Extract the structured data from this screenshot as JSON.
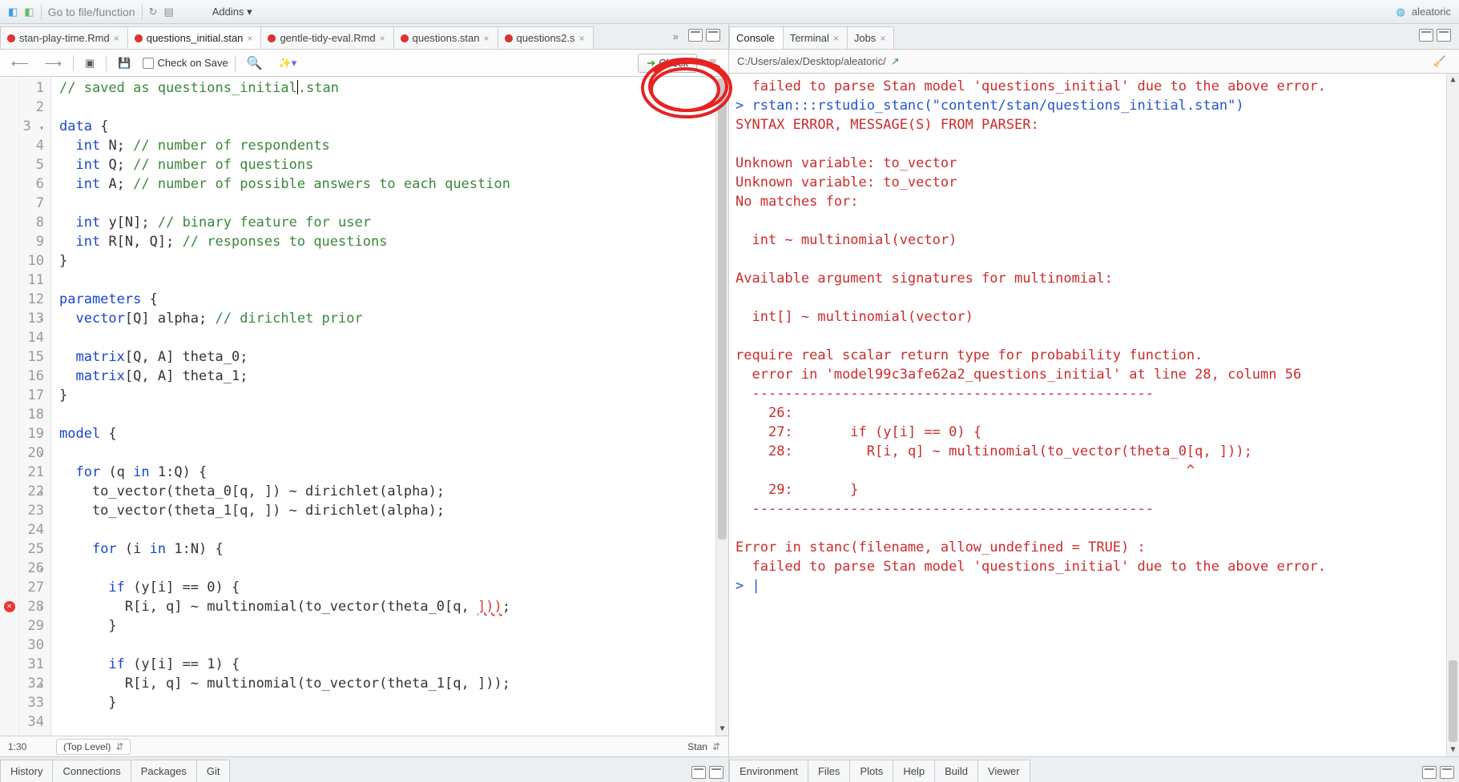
{
  "top": {
    "goto_placeholder": "Go to file/function",
    "addins_label": "Addins",
    "project_name": "aleatoric"
  },
  "editor": {
    "tabs": [
      {
        "label": "stan-play-time.Rmd",
        "active": false
      },
      {
        "label": "questions_initial.stan",
        "active": true
      },
      {
        "label": "gentle-tidy-eval.Rmd",
        "active": false
      },
      {
        "label": "questions.stan",
        "active": false
      },
      {
        "label": "questions2.s",
        "active": false
      }
    ],
    "toolbar": {
      "check_on_save": "Check on Save",
      "check_button": "Check"
    },
    "status": {
      "pos": "1:30",
      "scope": "(Top Level)",
      "lang": "Stan"
    },
    "lines": [
      {
        "n": 1,
        "fold": "",
        "html": "<span class='c-comment'>// saved as questions_initial<span class='cursor-bar'></span>.stan</span>"
      },
      {
        "n": 2,
        "fold": "",
        "html": ""
      },
      {
        "n": 3,
        "fold": "▾",
        "html": "<span class='c-key'>data</span> {"
      },
      {
        "n": 4,
        "fold": "",
        "html": "  <span class='c-type'>int</span> N; <span class='c-comment'>// number of respondents</span>"
      },
      {
        "n": 5,
        "fold": "",
        "html": "  <span class='c-type'>int</span> Q; <span class='c-comment'>// number of questions</span>"
      },
      {
        "n": 6,
        "fold": "",
        "html": "  <span class='c-type'>int</span> A; <span class='c-comment'>// number of possible answers to each question</span>"
      },
      {
        "n": 7,
        "fold": "",
        "html": ""
      },
      {
        "n": 8,
        "fold": "",
        "html": "  <span class='c-type'>int</span> y[N]; <span class='c-comment'>// binary feature for user</span>"
      },
      {
        "n": 9,
        "fold": "",
        "html": "  <span class='c-type'>int</span> R[N, Q]; <span class='c-comment'>// responses to questions</span>"
      },
      {
        "n": 10,
        "fold": "",
        "html": "}"
      },
      {
        "n": 11,
        "fold": "",
        "html": ""
      },
      {
        "n": 12,
        "fold": "▾",
        "html": "<span class='c-key'>parameters</span> {"
      },
      {
        "n": 13,
        "fold": "",
        "html": "  <span class='c-type'>vector</span>[Q] alpha; <span class='c-comment'>// dirichlet prior</span>"
      },
      {
        "n": 14,
        "fold": "",
        "html": ""
      },
      {
        "n": 15,
        "fold": "",
        "html": "  <span class='c-type'>matrix</span>[Q, A] theta_0;"
      },
      {
        "n": 16,
        "fold": "",
        "html": "  <span class='c-type'>matrix</span>[Q, A] theta_1;"
      },
      {
        "n": 17,
        "fold": "",
        "html": "}"
      },
      {
        "n": 18,
        "fold": "",
        "html": ""
      },
      {
        "n": 19,
        "fold": "▾",
        "html": "<span class='c-key'>model</span> {"
      },
      {
        "n": 20,
        "fold": "",
        "html": ""
      },
      {
        "n": 21,
        "fold": "▾",
        "html": "  <span class='c-key'>for</span> (q <span class='c-key'>in</span> 1:Q) {"
      },
      {
        "n": 22,
        "fold": "",
        "html": "    to_vector(theta_0[q, ]) ~ dirichlet(alpha);"
      },
      {
        "n": 23,
        "fold": "",
        "html": "    to_vector(theta_1[q, ]) ~ dirichlet(alpha);"
      },
      {
        "n": 24,
        "fold": "",
        "html": ""
      },
      {
        "n": 25,
        "fold": "▾",
        "html": "    <span class='c-key'>for</span> (i <span class='c-key'>in</span> 1:N) {"
      },
      {
        "n": 26,
        "fold": "",
        "html": ""
      },
      {
        "n": 27,
        "fold": "▾",
        "html": "      <span class='c-key'>if</span> (y[i] == 0) {"
      },
      {
        "n": 28,
        "fold": "",
        "err": true,
        "html": "        R[i, q] ~ multinomial(to_vector(theta_0[q, <span class='c-err'>]))</span>;"
      },
      {
        "n": 29,
        "fold": "",
        "html": "      }"
      },
      {
        "n": 30,
        "fold": "",
        "html": ""
      },
      {
        "n": 31,
        "fold": "▾",
        "html": "      <span class='c-key'>if</span> (y[i] == 1) {"
      },
      {
        "n": 32,
        "fold": "",
        "html": "        R[i, q] ~ multinomial(to_vector(theta_1[q, ]));"
      },
      {
        "n": 33,
        "fold": "",
        "html": "      }"
      },
      {
        "n": 34,
        "fold": "",
        "html": ""
      }
    ]
  },
  "left_bottom_tabs": [
    "History",
    "Connections",
    "Packages",
    "Git"
  ],
  "console": {
    "tabs": [
      {
        "label": "Console",
        "active": true
      },
      {
        "label": "Terminal",
        "active": false
      },
      {
        "label": "Jobs",
        "active": false
      }
    ],
    "path": "C:/Users/alex/Desktop/aleatoric/",
    "segments": [
      {
        "cls": "cons-red",
        "text": "  failed to parse Stan model 'questions_initial' due to the above error."
      },
      {
        "cls": "cons-blue",
        "text": "> rstan:::rstudio_stanc(\"content/stan/questions_initial.stan\")"
      },
      {
        "cls": "cons-red",
        "text": "SYNTAX ERROR, MESSAGE(S) FROM PARSER:"
      },
      {
        "cls": "cons-red",
        "text": ""
      },
      {
        "cls": "cons-red",
        "text": "Unknown variable: to_vector"
      },
      {
        "cls": "cons-red",
        "text": "Unknown variable: to_vector"
      },
      {
        "cls": "cons-red",
        "text": "No matches for: "
      },
      {
        "cls": "cons-red",
        "text": ""
      },
      {
        "cls": "cons-red",
        "text": "  int ~ multinomial(vector)"
      },
      {
        "cls": "cons-red",
        "text": ""
      },
      {
        "cls": "cons-red",
        "text": "Available argument signatures for multinomial:"
      },
      {
        "cls": "cons-red",
        "text": ""
      },
      {
        "cls": "cons-red",
        "text": "  int[] ~ multinomial(vector)"
      },
      {
        "cls": "cons-red",
        "text": ""
      },
      {
        "cls": "cons-red",
        "text": "require real scalar return type for probability function."
      },
      {
        "cls": "cons-red",
        "text": "  error in 'model99c3afe62a2_questions_initial' at line 28, column 56"
      },
      {
        "cls": "cons-red",
        "text": "  -------------------------------------------------"
      },
      {
        "cls": "cons-red",
        "text": "    26:"
      },
      {
        "cls": "cons-red",
        "text": "    27:       if (y[i] == 0) {"
      },
      {
        "cls": "cons-red",
        "text": "    28:         R[i, q] ~ multinomial(to_vector(theta_0[q, ]));"
      },
      {
        "cls": "cons-red",
        "text": "                                                       ^"
      },
      {
        "cls": "cons-red",
        "text": "    29:       }"
      },
      {
        "cls": "cons-red",
        "text": "  -------------------------------------------------"
      },
      {
        "cls": "cons-red",
        "text": ""
      },
      {
        "cls": "cons-red",
        "text": "Error in stanc(filename, allow_undefined = TRUE) : "
      },
      {
        "cls": "cons-red",
        "text": "  failed to parse Stan model 'questions_initial' due to the above error."
      },
      {
        "cls": "cons-blue",
        "text": "> |"
      }
    ]
  },
  "right_bottom_tabs": [
    "Environment",
    "Files",
    "Plots",
    "Help",
    "Build",
    "Viewer"
  ]
}
